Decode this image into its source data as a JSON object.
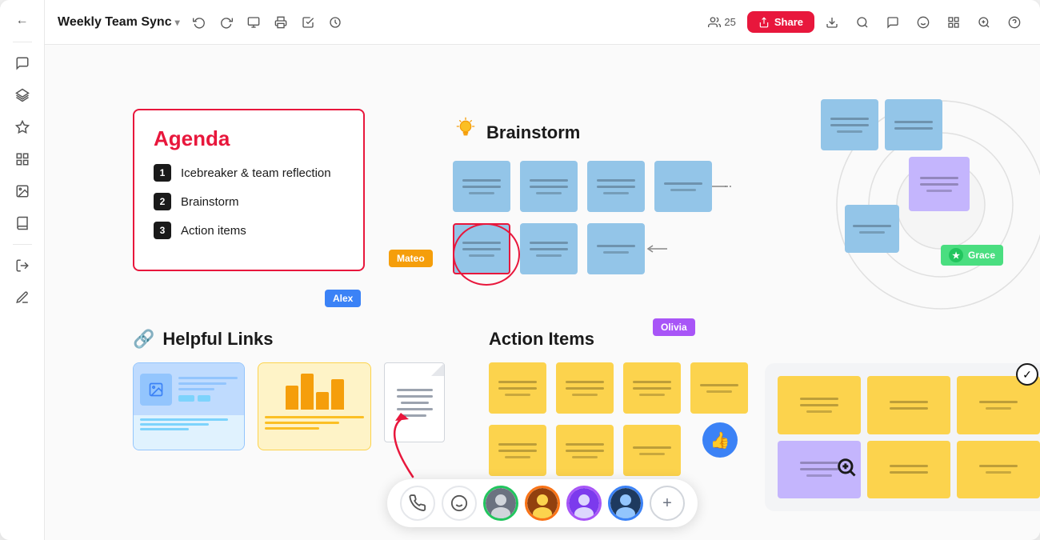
{
  "app": {
    "title": "Weekly Team Sync",
    "title_chevron": "▾"
  },
  "toolbar": {
    "users_count": "25",
    "share_label": "Share",
    "tools": [
      "↩",
      "↪",
      "⬜",
      "⬜",
      "☑",
      "⊙"
    ]
  },
  "agenda": {
    "title": "Agenda",
    "items": [
      {
        "num": "1",
        "label": "Icebreaker & team reflection"
      },
      {
        "num": "2",
        "label": "Brainstorm"
      },
      {
        "num": "3",
        "label": "Action items"
      }
    ]
  },
  "brainstorm": {
    "title": "Brainstorm",
    "icon": "💡"
  },
  "helpful_links": {
    "title": "Helpful Links",
    "icon": "🔗"
  },
  "action_items": {
    "title": "Action Items"
  },
  "cursors": {
    "mateo": "Mateo",
    "alex": "Alex",
    "olivia": "Olivia",
    "grace": "Grace"
  },
  "bottom_toolbar": {
    "phone_icon": "📞",
    "emoji_icon": "😊",
    "add_icon": "+"
  },
  "sidebar": {
    "items": [
      {
        "name": "back-icon",
        "icon": "←"
      },
      {
        "name": "comment-icon",
        "icon": "💬"
      },
      {
        "name": "layers-icon",
        "icon": "⧉"
      },
      {
        "name": "star-icon",
        "icon": "☆"
      },
      {
        "name": "grid-icon",
        "icon": "⊞"
      },
      {
        "name": "image-icon",
        "icon": "🖼"
      },
      {
        "name": "book-icon",
        "icon": "📚"
      },
      {
        "name": "export-icon",
        "icon": "↗"
      },
      {
        "name": "pen-icon",
        "icon": "✏"
      }
    ]
  }
}
